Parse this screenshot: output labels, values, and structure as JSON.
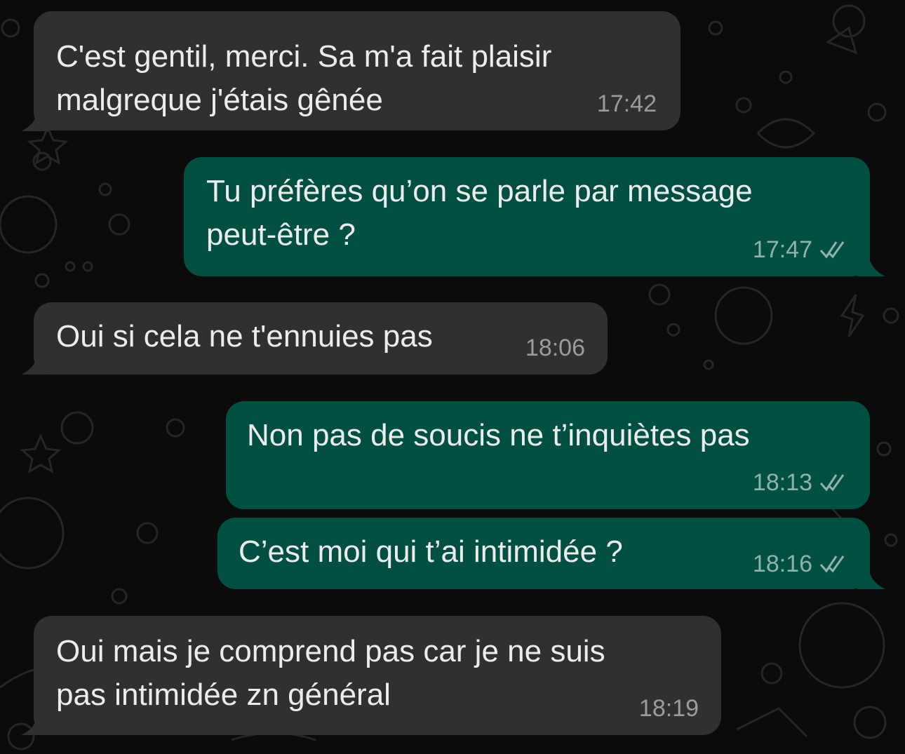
{
  "chat": {
    "theme": {
      "background": "#0b0b0b",
      "incoming_bubble": "#303030",
      "outgoing_bubble": "#025041",
      "text": "#ececec",
      "incoming_time": "#9c9c9c",
      "outgoing_time": "#8fb3aa"
    },
    "messages": [
      {
        "direction": "incoming",
        "text": "C'est gentil, merci. Sa m'a fait plaisir\nmalgreque j'étais gênée",
        "time": "17:42"
      },
      {
        "direction": "outgoing",
        "text": "Tu préfères qu’on se parle par message\npeut-être ?",
        "time": "17:47",
        "status_icon": "double-check-icon"
      },
      {
        "direction": "incoming",
        "text": "Oui si cela ne t'ennuies pas",
        "time": "18:06"
      },
      {
        "direction": "outgoing",
        "text": "Non pas de soucis ne t’inquiètes pas",
        "time": "18:13",
        "status_icon": "double-check-icon"
      },
      {
        "direction": "outgoing",
        "text": "C’est moi qui t’ai intimidée ?",
        "time": "18:16",
        "status_icon": "double-check-icon"
      },
      {
        "direction": "incoming",
        "text": "Oui mais je comprend pas car je ne suis\npas intimidée zn général",
        "time": "18:19"
      }
    ]
  }
}
